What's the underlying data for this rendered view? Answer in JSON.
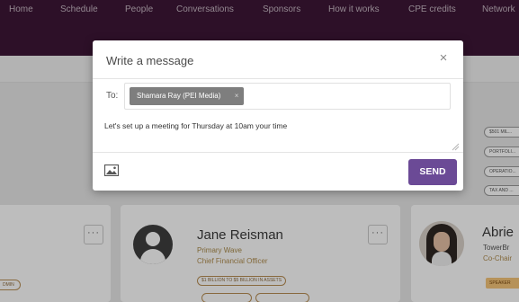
{
  "top_nav": {
    "items": [
      "Home",
      "Schedule",
      "People",
      "Conversations",
      "Sponsors",
      "How it works",
      "CPE credits",
      "Network"
    ]
  },
  "cards": {
    "left": {
      "more_label": "···",
      "tag": "DMIN"
    },
    "center": {
      "name": "Jane Reisman",
      "organization": "Primary Wave",
      "title": "Chief Financial Officer",
      "more_label": "···",
      "tags": [
        "$1 BILLION TO $5 BILLION IN ASSETS",
        "",
        ""
      ]
    },
    "right": {
      "name": "Abrie",
      "organization": "TowerBr",
      "title": "Co-Chair",
      "badge": "SPEAKER",
      "tags": [
        "$501 MIL...",
        "PORTFOLI...",
        "OPERATIO...",
        "TAX AND ..."
      ]
    }
  },
  "modal": {
    "title": "Write a message",
    "close_icon": "close-icon",
    "to_label": "To:",
    "recipient": "Shamara Ray (PEI Media)",
    "recipient_remove_icon": "close-icon",
    "message": "Let's set up a meeting for Thursday at 10am your time",
    "attach_icon": "image-icon",
    "send_label": "SEND"
  },
  "colors": {
    "nav_background": "#3d1637",
    "send_button": "#6b4a96",
    "recipient_chip": "#7e7e7e",
    "tag_border": "#b98f55"
  }
}
